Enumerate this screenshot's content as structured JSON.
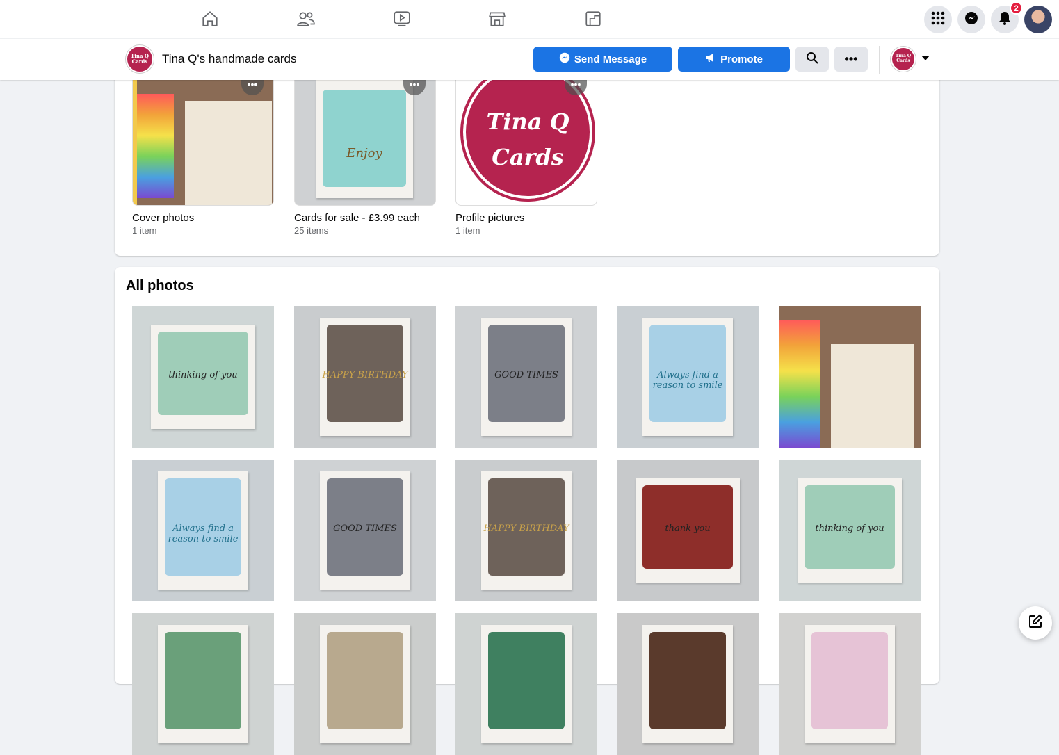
{
  "nav": {
    "icons": [
      "home-icon",
      "friends-icon",
      "watch-icon",
      "marketplace-icon",
      "pages-icon"
    ],
    "notifications_count": "2"
  },
  "page": {
    "name": "Tina Q's handmade cards",
    "logo_text": "Tina Q Cards",
    "send_message": "Send Message",
    "promote": "Promote"
  },
  "albums": [
    {
      "name": "Cover photos",
      "count": "1 item"
    },
    {
      "name": "Cards for sale - £3.99 each",
      "count": "25 items"
    },
    {
      "name": "Profile pictures",
      "count": "1 item"
    }
  ],
  "all_photos": {
    "title": "All photos",
    "photos": [
      {
        "bg": "#cfd6d6",
        "inner": "#9fcdb8",
        "text": "thinking of you"
      },
      {
        "bg": "#c9ccce",
        "inner": "#6e625a",
        "text": "HAPPY BIRTHDAY"
      },
      {
        "bg": "#cfd2d4",
        "inner": "#7c7f88",
        "text": "GOOD TIMES"
      },
      {
        "bg": "#c9cfd3",
        "inner": "#a8d0e6",
        "text": "Always find a reason to smile"
      },
      {
        "bg": "#8a6b55",
        "inner": "",
        "text": ""
      },
      {
        "bg": "#c9cfd3",
        "inner": "#a8d0e6",
        "text": "Always find a reason to smile"
      },
      {
        "bg": "#cfd2d4",
        "inner": "#7c7f88",
        "text": "GOOD TIMES"
      },
      {
        "bg": "#c9ccce",
        "inner": "#6e625a",
        "text": "HAPPY BIRTHDAY"
      },
      {
        "bg": "#c7c9cb",
        "inner": "#8e2e2a",
        "text": "thank you"
      },
      {
        "bg": "#cfd6d6",
        "inner": "#9fcdb8",
        "text": "thinking of you"
      },
      {
        "bg": "#cfd3d2",
        "inner": "#6aa07a",
        "text": ""
      },
      {
        "bg": "#cbcdcc",
        "inner": "#b8a98e",
        "text": ""
      },
      {
        "bg": "#cfd3d2",
        "inner": "#3f8060",
        "text": ""
      },
      {
        "bg": "#c9c9c9",
        "inner": "#5a3a2c",
        "text": ""
      },
      {
        "bg": "#d2d2d0",
        "inner": "#e6c3d6",
        "text": ""
      }
    ]
  },
  "colors": {
    "accent": "#1b74e4",
    "brand": "#b5234f"
  }
}
